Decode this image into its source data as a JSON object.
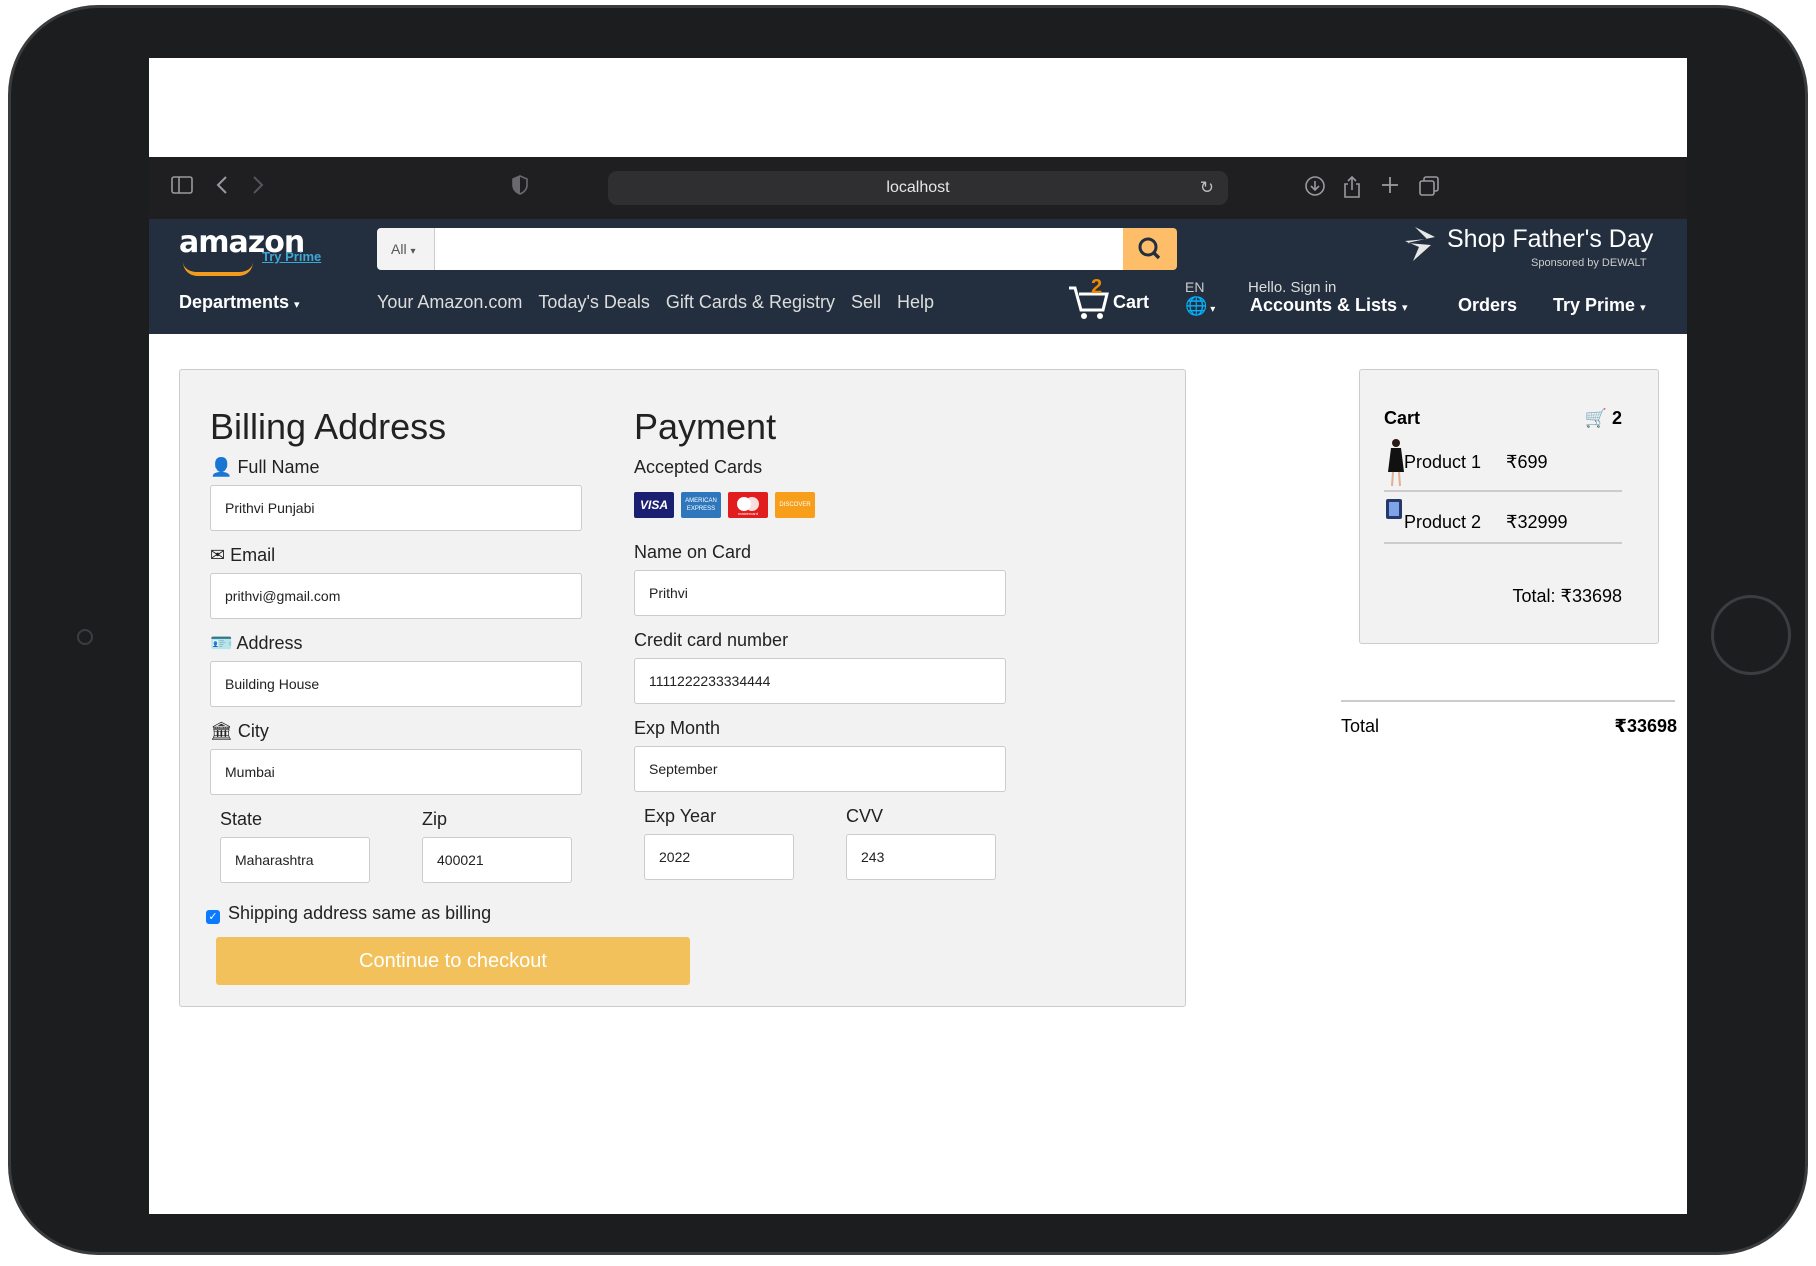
{
  "browser": {
    "url": "localhost"
  },
  "amazon": {
    "logo_text": "amazon",
    "logo_sub": "Try Prime",
    "search_category": "All",
    "search_placeholder": "",
    "promo_title": "Shop Father's Day",
    "promo_sub": "Sponsored by DEWALT",
    "departments": "Departments",
    "nav_links": [
      "Your Amazon.com",
      "Today's Deals",
      "Gift Cards & Registry",
      "Sell",
      "Help"
    ],
    "cart_count": "2",
    "cart_label": "Cart",
    "lang": "EN",
    "hello": "Hello. Sign in",
    "accounts": "Accounts & Lists",
    "orders": "Orders",
    "try_prime": "Try Prime"
  },
  "billing": {
    "title": "Billing Address",
    "full_name_label": "Full Name",
    "full_name": "Prithvi Punjabi",
    "email_label": "Email",
    "email": "prithvi@gmail.com",
    "address_label": "Address",
    "address": "Building House",
    "city_label": "City",
    "city": "Mumbai",
    "state_label": "State",
    "state": "Maharashtra",
    "zip_label": "Zip",
    "zip": "400021",
    "same_as_billing": "Shipping address same as billing",
    "checkout_btn": "Continue to checkout"
  },
  "payment": {
    "title": "Payment",
    "accepted_cards_label": "Accepted Cards",
    "cards": [
      "visa-card-icon",
      "amex-card-icon",
      "mastercard-icon",
      "discover-card-icon"
    ],
    "card_text_visa": "VISA",
    "card_text_amex": "AMERICAN EXPRESS",
    "card_text_mastercard": "mastercard",
    "card_text_discover": "DISCOVER",
    "name_on_card_label": "Name on Card",
    "name_on_card": "Prithvi",
    "cc_number_label": "Credit card number",
    "cc_number": "1111222233334444",
    "exp_month_label": "Exp Month",
    "exp_month": "September",
    "exp_year_label": "Exp Year",
    "exp_year": "2022",
    "cvv_label": "CVV",
    "cvv": "243"
  },
  "cart": {
    "title": "Cart",
    "count": "2",
    "items": [
      {
        "name": "Product 1",
        "price": "₹699"
      },
      {
        "name": "Product 2",
        "price": "₹32999"
      }
    ],
    "total_text": "Total: ₹33698",
    "summary_label": "Total",
    "summary_value": "₹33698"
  },
  "colors": {
    "header_bg": "#232f3e",
    "search_btn": "#febd69",
    "checkout_btn": "#f2c15b",
    "cart_badge": "#f08804"
  }
}
